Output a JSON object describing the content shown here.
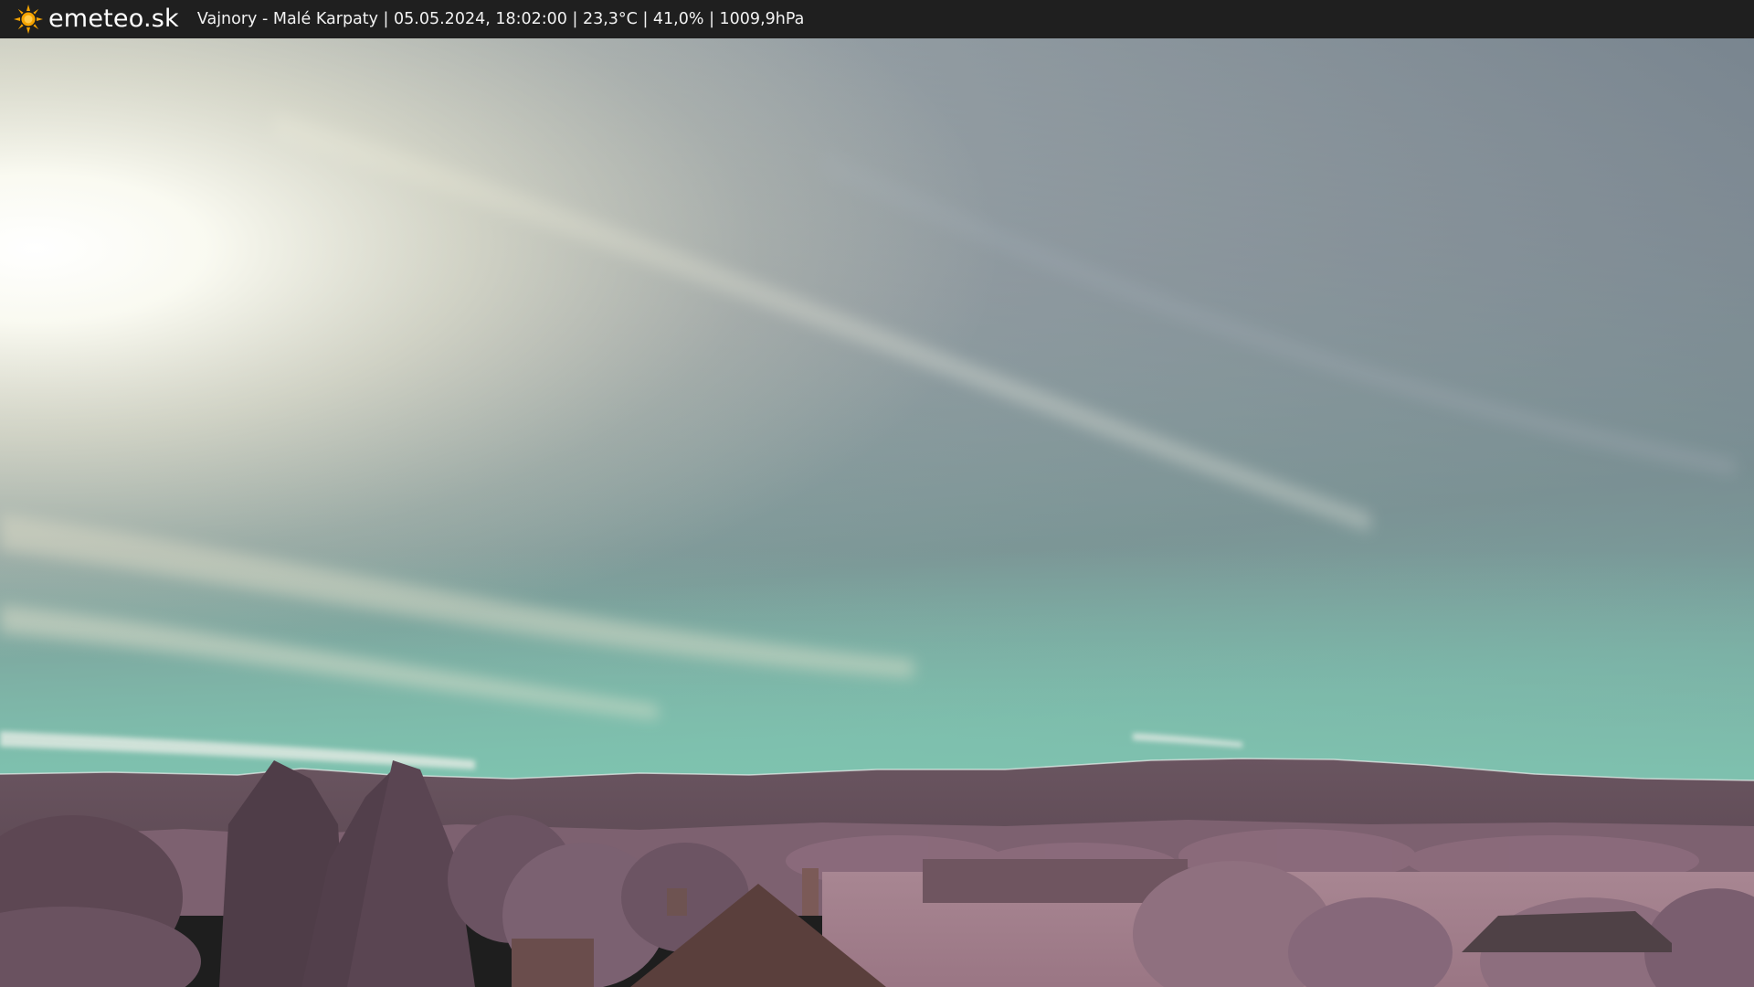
{
  "header": {
    "brand": "emeteo.sk",
    "caption": "Vajnory - Malé Karpaty | 05.05.2024, 18:02:00 | 23,3°C | 41,0% | 1009,9hPa",
    "logo_icon": "sun-icon",
    "background_color": "#1f1f1f",
    "logo_color": "#f5a300"
  },
  "scene": {
    "description_icon": "webcam-landscape",
    "sky_colors": [
      "#f4f3e8",
      "#c9cfc7",
      "#8e9aa2",
      "#6f8b8c",
      "#7cb6a6"
    ],
    "ground_colors": [
      "#6e5560",
      "#8a6777",
      "#a07f8c",
      "#b89aa5"
    ]
  }
}
